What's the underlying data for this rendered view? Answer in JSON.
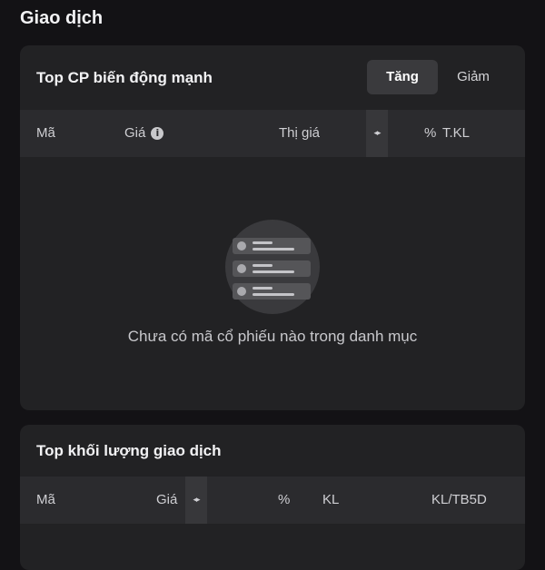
{
  "page": {
    "title": "Giao dịch"
  },
  "top_movers": {
    "title": "Top CP biến động mạnh",
    "tabs": [
      {
        "label": "Tăng",
        "active": true
      },
      {
        "label": "Giảm",
        "active": false
      }
    ],
    "columns": {
      "symbol": "Mã",
      "price": "Giá",
      "market_price": "Thị giá",
      "percent": "%",
      "volume": "T.KL"
    },
    "empty_message": "Chưa có mã cổ phiếu nào trong danh mục"
  },
  "top_volume": {
    "title": "Top khối lượng giao dịch",
    "columns": {
      "symbol": "Mã",
      "price": "Giá",
      "percent": "%",
      "volume": "KL",
      "volume_ratio": "KL/TB5D"
    }
  },
  "icons": {
    "info": "info-icon",
    "sort": "horizontal-sort-arrows-icon",
    "empty_list": "empty-list-illustration"
  },
  "colors": {
    "background": "#131215",
    "card": "#222224",
    "table_header": "#2b2b2e",
    "active_tab": "#3a3a3d"
  }
}
